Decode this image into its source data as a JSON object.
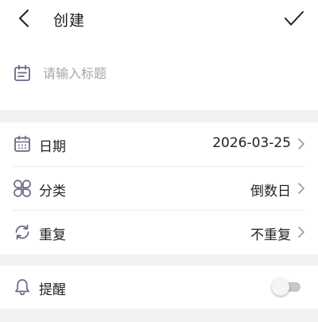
{
  "header": {
    "back_icon": "chevron-left-icon",
    "title": "创建",
    "confirm_icon": "check-icon"
  },
  "title_input": {
    "icon": "calendar-note-icon",
    "placeholder": "请输入标题",
    "value": ""
  },
  "rows": {
    "date": {
      "icon": "calendar-icon",
      "label": "日期",
      "value": "2026-03-25"
    },
    "category": {
      "icon": "clover-icon",
      "label": "分类",
      "value": "倒数日"
    },
    "repeat": {
      "icon": "refresh-icon",
      "label": "重复",
      "value": "不重复"
    },
    "reminder": {
      "icon": "bell-icon",
      "label": "提醒",
      "enabled": false
    }
  },
  "colors": {
    "icon": "#6b6886",
    "separator": "#f2f2f3",
    "placeholder": "#a6a6a6"
  }
}
